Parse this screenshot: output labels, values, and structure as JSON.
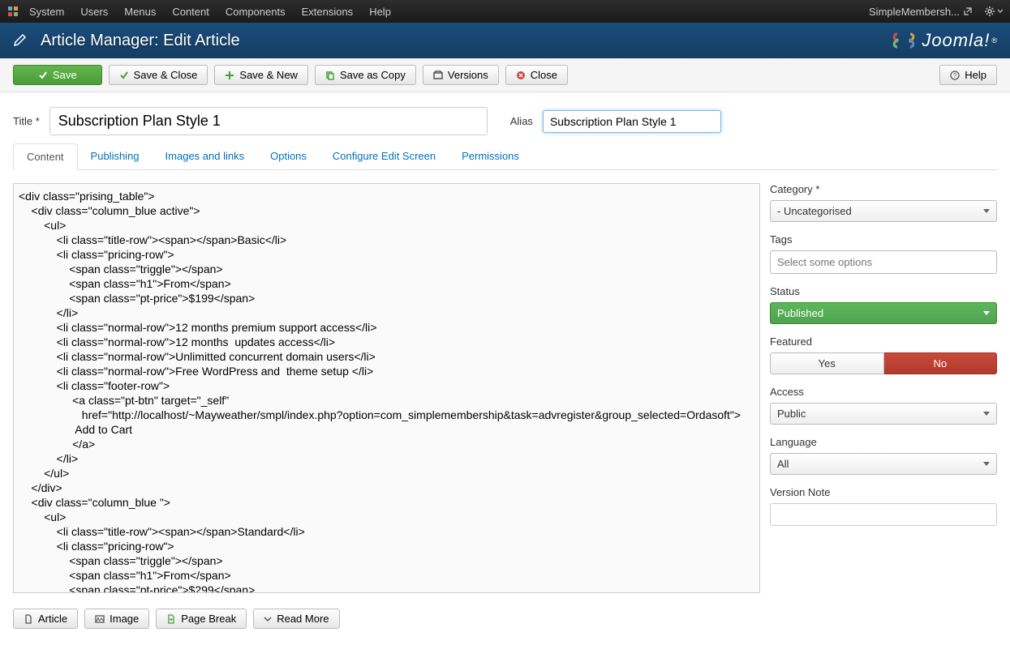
{
  "adminBar": {
    "menus": [
      "System",
      "Users",
      "Menus",
      "Content",
      "Components",
      "Extensions",
      "Help"
    ],
    "siteName": "SimpleMembersh..."
  },
  "header": {
    "title": "Article Manager: Edit Article",
    "brand": "Joomla!"
  },
  "toolbar": {
    "save": "Save",
    "saveClose": "Save & Close",
    "saveNew": "Save & New",
    "saveCopy": "Save as Copy",
    "versions": "Versions",
    "close": "Close",
    "help": "Help"
  },
  "form": {
    "titleLabel": "Title *",
    "titleValue": "Subscription Plan Style 1",
    "aliasLabel": "Alias",
    "aliasValue": "Subscription Plan Style 1"
  },
  "tabs": [
    "Content",
    "Publishing",
    "Images and links",
    "Options",
    "Configure Edit Screen",
    "Permissions"
  ],
  "activeTab": 0,
  "editorContent": "<div class=\"prising_table\">\n    <div class=\"column_blue active\">\n        <ul>\n            <li class=\"title-row\"><span></span>Basic</li>\n            <li class=\"pricing-row\">\n                <span class=\"triggle\"></span>\n                <span class=\"h1\">From</span>\n                <span class=\"pt-price\">$199</span>\n            </li>\n            <li class=\"normal-row\">12 months premium support access</li>\n            <li class=\"normal-row\">12 months  updates access</li>\n            <li class=\"normal-row\">Unlimitted concurrent domain users</li>\n            <li class=\"normal-row\">Free WordPress and  theme setup </li>\n            <li class=\"footer-row\">\n                 <a class=\"pt-btn\" target=\"_self\"\n                    href=\"http://localhost/~Mayweather/smpl/index.php?option=com_simplemembership&task=advregister&group_selected=Ordasoft\">\n                  Add to Cart\n                 </a>\n            </li>\n        </ul>\n    </div>\n    <div class=\"column_blue \">\n        <ul>\n            <li class=\"title-row\"><span></span>Standard</li>\n            <li class=\"pricing-row\">\n                <span class=\"triggle\"></span>\n                <span class=\"h1\">From</span>\n                <span class=\"pt-price\">$299</span>",
  "sidebar": {
    "categoryLabel": "Category *",
    "categoryValue": "- Uncategorised",
    "tagsLabel": "Tags",
    "tagsPlaceholder": "Select some options",
    "statusLabel": "Status",
    "statusValue": "Published",
    "featuredLabel": "Featured",
    "featuredYes": "Yes",
    "featuredNo": "No",
    "accessLabel": "Access",
    "accessValue": "Public",
    "languageLabel": "Language",
    "languageValue": "All",
    "versionNoteLabel": "Version Note"
  },
  "bottomButtons": {
    "article": "Article",
    "image": "Image",
    "pageBreak": "Page Break",
    "readMore": "Read More"
  }
}
